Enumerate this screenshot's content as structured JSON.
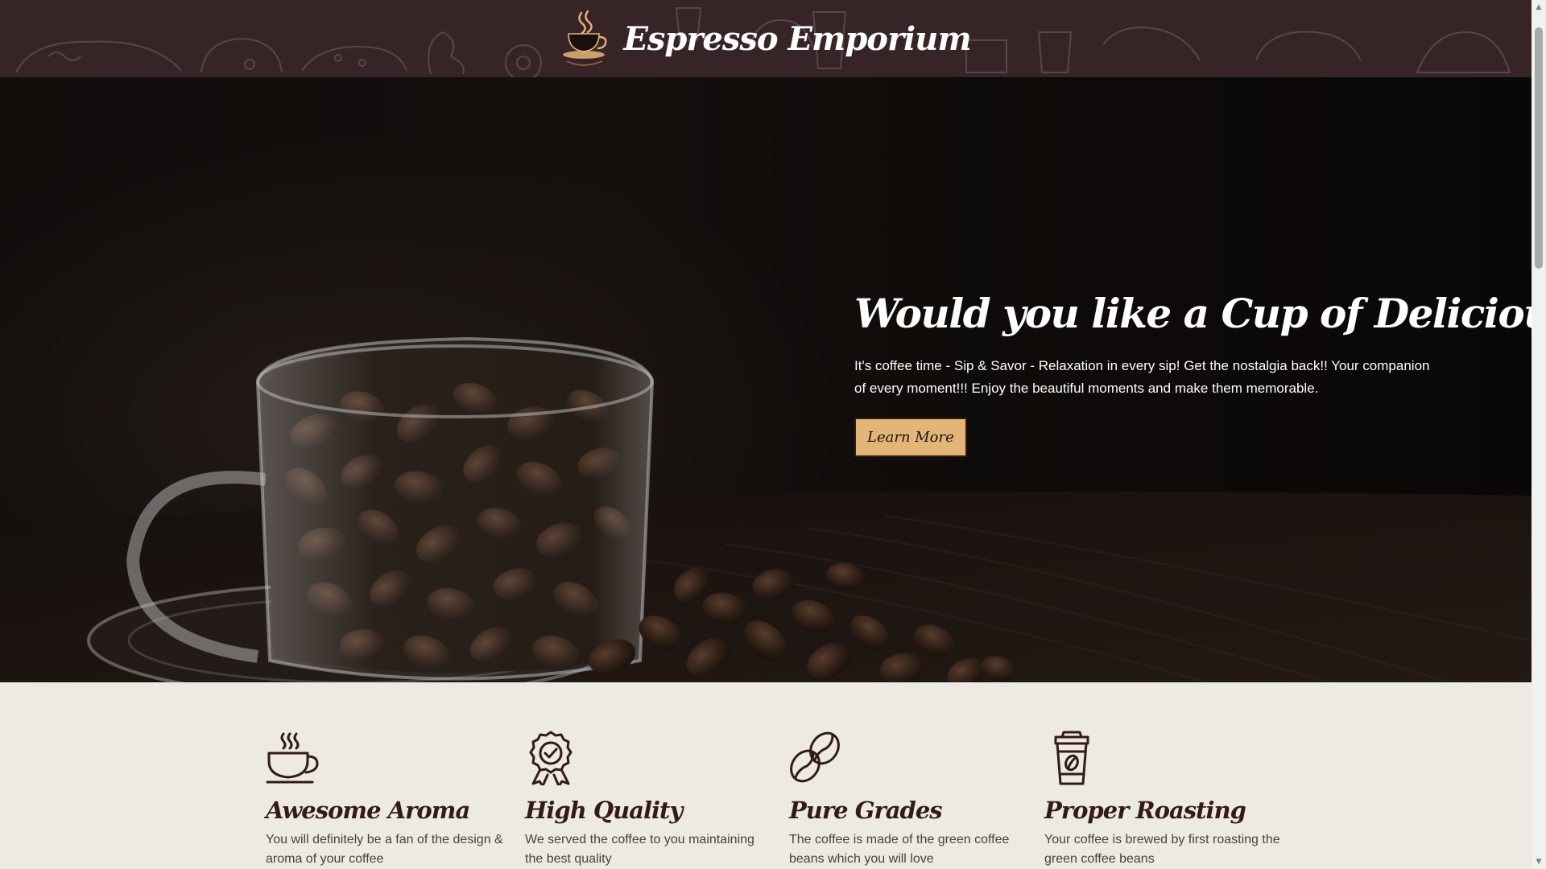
{
  "header": {
    "logo_icon": "coffee-cup-logo-icon",
    "brand_name": "Espresso Emporium",
    "background_color": "#372426"
  },
  "hero": {
    "title": "Would you like a Cup of Delicious Coffee?",
    "text": "It's coffee time - Sip & Savor - Relaxation in every sip! Get the nostalgia back!! Your companion of every moment!!! Enjoy the beautiful moments and make them memorable.",
    "button_label": "Learn More",
    "button_color": "#E3B577",
    "image": "glass-cup-of-coffee-beans"
  },
  "features": [
    {
      "icon": "coffee-cup-icon",
      "title": "Awesome Aroma",
      "text": "You will definitely be a fan of the design & aroma of your coffee"
    },
    {
      "icon": "quality-badge-icon",
      "title": "High Quality",
      "text": "We served the coffee to you maintaining the best quality"
    },
    {
      "icon": "coffee-beans-icon",
      "title": "Pure Grades",
      "text": "The coffee is made of the green coffee beans which you will love"
    },
    {
      "icon": "takeaway-cup-icon",
      "title": "Proper Roasting",
      "text": "Your coffee is brewed by first roasting the green coffee beans"
    }
  ],
  "colors": {
    "accent": "#E3B577",
    "dark_brown": "#331A15",
    "page_background": "#ECEAE3"
  }
}
